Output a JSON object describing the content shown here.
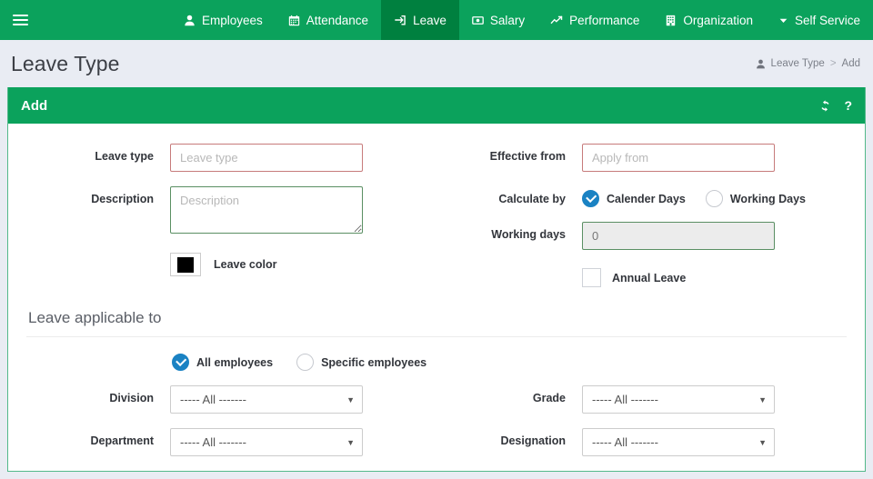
{
  "nav": {
    "menu_icon": "hamburger-icon",
    "items": [
      {
        "label": "Employees",
        "icon": "user-icon",
        "active": false
      },
      {
        "label": "Attendance",
        "icon": "calendar-icon",
        "active": false
      },
      {
        "label": "Leave",
        "icon": "signin-icon",
        "active": true
      },
      {
        "label": "Salary",
        "icon": "money-icon",
        "active": false
      },
      {
        "label": "Performance",
        "icon": "chart-line-icon",
        "active": false
      },
      {
        "label": "Organization",
        "icon": "building-icon",
        "active": false
      },
      {
        "label": "Self Service",
        "icon": "caret-down-icon",
        "active": false
      }
    ]
  },
  "page": {
    "title": "Leave Type",
    "breadcrumb": {
      "icon": "user-icon",
      "parent": "Leave Type",
      "separator": ">",
      "current": "Add"
    }
  },
  "card": {
    "title": "Add",
    "tools": {
      "refresh": "refresh-icon",
      "help": "?"
    }
  },
  "form": {
    "leave_type": {
      "label": "Leave type",
      "value": "",
      "placeholder": "Leave type"
    },
    "description": {
      "label": "Description",
      "value": "",
      "placeholder": "Description"
    },
    "leave_color": {
      "label": "Leave color",
      "value": "#000000"
    },
    "effective_from": {
      "label": "Effective from",
      "value": "",
      "placeholder": "Apply from"
    },
    "calculate_by": {
      "label": "Calculate by",
      "options": [
        "Calender Days",
        "Working Days"
      ],
      "selected": "Calender Days"
    },
    "working_days": {
      "label": "Working days",
      "value": "0",
      "disabled": true
    },
    "annual_leave": {
      "label": "Annual Leave",
      "checked": false
    }
  },
  "applicable": {
    "section_title": "Leave applicable to",
    "scope": {
      "options": [
        "All employees",
        "Specific employees"
      ],
      "selected": "All employees"
    },
    "filters": [
      {
        "label": "Division",
        "value": "----- All -------",
        "options": [
          "----- All -------"
        ]
      },
      {
        "label": "Grade",
        "value": "----- All -------",
        "options": [
          "----- All -------"
        ]
      },
      {
        "label": "Department",
        "value": "----- All -------",
        "options": [
          "----- All -------"
        ]
      },
      {
        "label": "Designation",
        "value": "----- All -------",
        "options": [
          "----- All -------"
        ]
      }
    ]
  },
  "colors": {
    "brand_green": "#0ba25c",
    "active_green": "#00803f",
    "page_bg": "#e9ecf3",
    "accent_blue": "#1a82c3",
    "error_border": "#c77b7b"
  }
}
